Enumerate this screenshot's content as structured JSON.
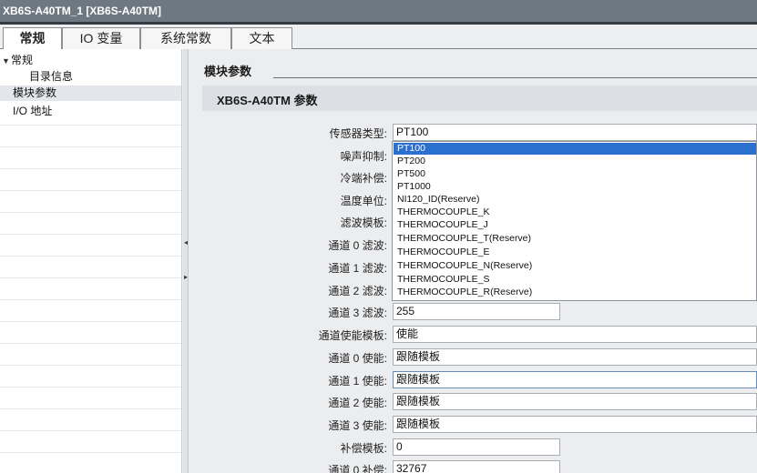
{
  "window": {
    "title": "XB6S-A40TM_1 [XB6S-A40TM]"
  },
  "tabs": [
    {
      "label": "常规"
    },
    {
      "label": "IO 变量"
    },
    {
      "label": "系统常数"
    },
    {
      "label": "文本"
    }
  ],
  "tree": {
    "items": [
      {
        "label": "常规"
      },
      {
        "label": "目录信息"
      },
      {
        "label": "模块参数"
      },
      {
        "label": "I/O 地址"
      }
    ]
  },
  "main": {
    "section_title": "模块参数",
    "subsection_title": "XB6S-A40TM 参数",
    "params": [
      {
        "label": "传感器类型:",
        "value": "PT100"
      },
      {
        "label": "噪声抑制:",
        "value": ""
      },
      {
        "label": "冷端补偿:",
        "value": ""
      },
      {
        "label": "温度单位:",
        "value": ""
      },
      {
        "label": "滤波模板:",
        "value": ""
      },
      {
        "label": "通道 0 滤波:",
        "value": ""
      },
      {
        "label": "通道 1 滤波:",
        "value": ""
      },
      {
        "label": "通道 2 滤波:",
        "value": ""
      },
      {
        "label": "通道 3 滤波:",
        "value": "255"
      },
      {
        "label": "通道使能模板:",
        "value": "使能"
      },
      {
        "label": "通道 0 使能:",
        "value": "跟随模板"
      },
      {
        "label": "通道 1 使能:",
        "value": "跟随模板"
      },
      {
        "label": "通道 2 使能:",
        "value": "跟随模板"
      },
      {
        "label": "通道 3 使能:",
        "value": "跟随模板"
      },
      {
        "label": "补偿模板:",
        "value": "0"
      },
      {
        "label": "通道 0 补偿:",
        "value": "32767"
      }
    ],
    "dropdown_options": [
      "PT100",
      "PT200",
      "PT500",
      "PT1000",
      "NI120_ID(Reserve)",
      "THERMOCOUPLE_K",
      "THERMOCOUPLE_J",
      "THERMOCOUPLE_T(Reserve)",
      "THERMOCOUPLE_E",
      "THERMOCOUPLE_N(Reserve)",
      "THERMOCOUPLE_S",
      "THERMOCOUPLE_R(Reserve)"
    ],
    "dropdown_selected": "PT100"
  },
  "colors": {
    "titlebar": "#6e7882",
    "selection": "#2b6fcf",
    "panel": "#ecedef"
  },
  "icons": {
    "tree_caret": "triangle-down-icon",
    "splitter_arrows": [
      "collapse-left-icon",
      "expand-right-icon"
    ]
  }
}
